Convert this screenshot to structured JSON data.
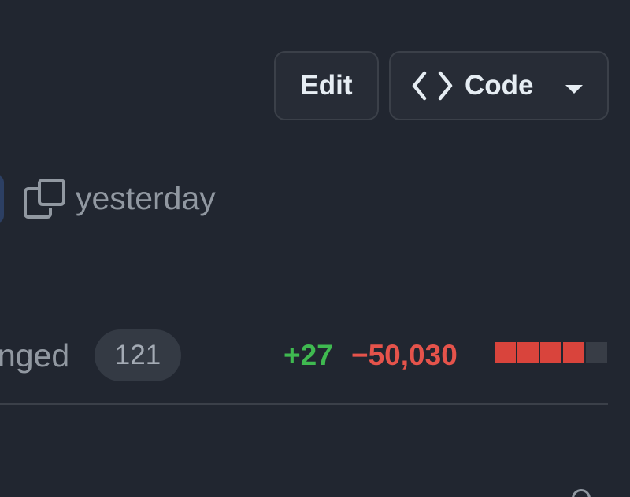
{
  "header": {
    "edit_label": "Edit",
    "code_label": "Code",
    "code_icon": "code-brackets-icon",
    "caret_icon": "triangle-down-icon"
  },
  "meta": {
    "copy_icon": "copy-icon",
    "timestamp": "yesterday"
  },
  "files": {
    "label": "nged",
    "count": "121",
    "additions": "+27",
    "deletions": "−50,030",
    "diffstat_blocks": [
      "deleted",
      "deleted",
      "deleted",
      "deleted",
      "neutral"
    ]
  },
  "colors": {
    "background": "#212630",
    "additions": "#3fb950",
    "deletions": "#e5534b",
    "muted_text": "#9198a1",
    "button_border": "#3b4049"
  }
}
